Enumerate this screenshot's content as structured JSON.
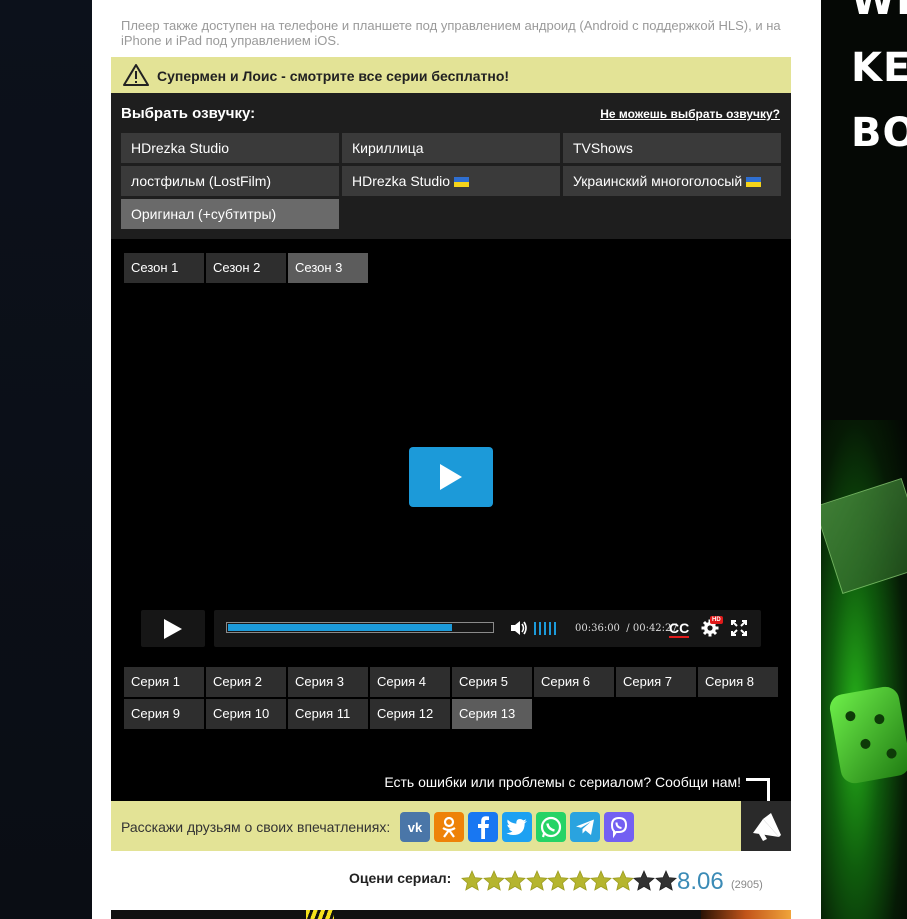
{
  "player_note": "Плеер также доступен на телефоне и планшете под управлением андроид (Android с поддержкой HLS), и на iPhone и iPad под управлением iOS.",
  "warning": {
    "text": "Супермен и Лоис - смотрите все серии бесплатно!",
    "icon": "warning-icon"
  },
  "dub": {
    "label": "Выбрать озвучку:",
    "help_link": "Не можешь выбрать озвучку?",
    "options": [
      {
        "label": "HDrezka Studio",
        "flag": false,
        "active": false
      },
      {
        "label": "Кириллица",
        "flag": false,
        "active": false
      },
      {
        "label": "TVShows",
        "flag": false,
        "active": false
      },
      {
        "label": "лостфильм (LostFilm)",
        "flag": false,
        "active": false
      },
      {
        "label": "HDrezka Studio",
        "flag": true,
        "active": false
      },
      {
        "label": "Украинский многоголосый",
        "flag": true,
        "active": false
      },
      {
        "label": "Оригинал (+субтитры)",
        "flag": false,
        "active": true
      }
    ]
  },
  "seasons": [
    {
      "label": "Сезон 1",
      "active": false
    },
    {
      "label": "Сезон 2",
      "active": false
    },
    {
      "label": "Сезон 3",
      "active": true
    }
  ],
  "player": {
    "progress": 0.85,
    "time_current": "00:36:00",
    "time_separator": "/",
    "time_total": "00:42:27",
    "cc_label": "CC",
    "hd_badge": "HD",
    "accent_color": "#1c9ad9"
  },
  "episodes": [
    {
      "label": "Серия 1",
      "active": false
    },
    {
      "label": "Серия 2",
      "active": false
    },
    {
      "label": "Серия 3",
      "active": false
    },
    {
      "label": "Серия 4",
      "active": false
    },
    {
      "label": "Серия 5",
      "active": false
    },
    {
      "label": "Серия 6",
      "active": false
    },
    {
      "label": "Серия 7",
      "active": false
    },
    {
      "label": "Серия 8",
      "active": false
    },
    {
      "label": "Серия 9",
      "active": false
    },
    {
      "label": "Серия 10",
      "active": false
    },
    {
      "label": "Серия 11",
      "active": false
    },
    {
      "label": "Серия 12",
      "active": false
    },
    {
      "label": "Серия 13",
      "active": true
    }
  ],
  "report_text": "Есть ошибки или проблемы с сериалом? Сообщи нам!",
  "share": {
    "text": "Расскажи друзьям о своих впечатлениях:",
    "networks": [
      {
        "name": "vk-icon",
        "color": "#4a76a8"
      },
      {
        "name": "odnoklassniki-icon",
        "color": "#ee8208"
      },
      {
        "name": "facebook-icon",
        "color": "#1877f2"
      },
      {
        "name": "twitter-icon",
        "color": "#1da1f2"
      },
      {
        "name": "whatsapp-icon",
        "color": "#25d366"
      },
      {
        "name": "telegram-icon",
        "color": "#2aa3df"
      },
      {
        "name": "viber-icon",
        "color": "#7360f2"
      }
    ]
  },
  "rating": {
    "label": "Оцени сериал:",
    "stars_total": 10,
    "stars_filled": 8,
    "score": "8.06",
    "votes": "(2905)"
  },
  "side_ad": {
    "lines": [
      "WIN",
      "KEE",
      "BO"
    ]
  }
}
